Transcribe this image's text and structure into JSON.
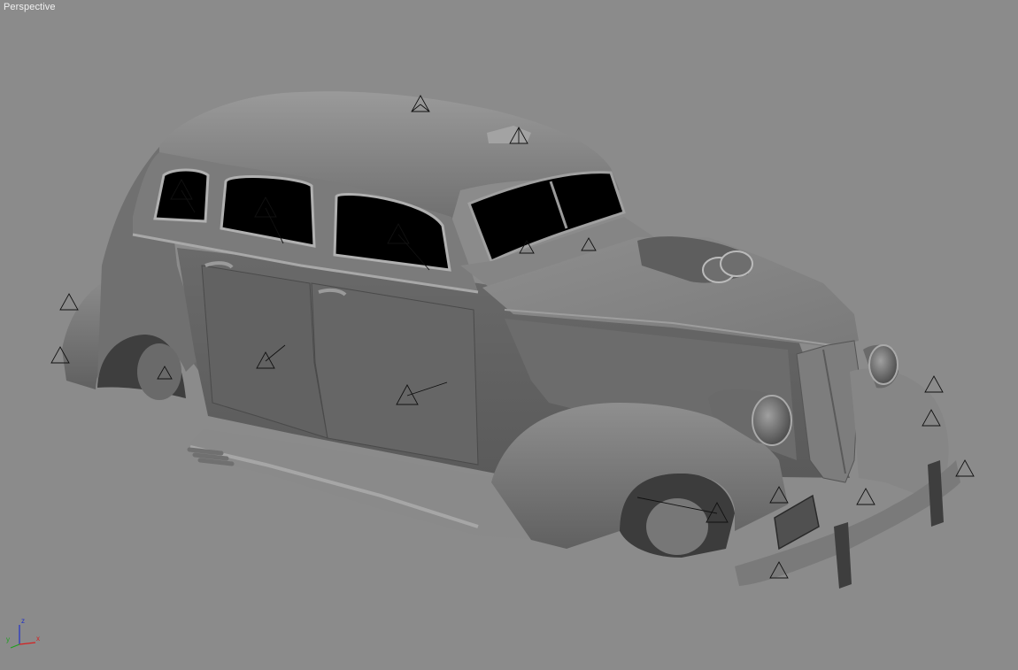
{
  "viewport": {
    "label": "Perspective",
    "background": "#8b8b8b"
  },
  "model": {
    "name": "car-body",
    "body_color": "#7e7e7e",
    "window_color": "#000000"
  },
  "axis_gizmo": {
    "x_label": "x",
    "y_label": "y",
    "z_label": "z",
    "x_color": "#d42020",
    "y_color": "#1ea01e",
    "z_color": "#2030c8"
  },
  "icons": {
    "helper": "light-helper-icon"
  }
}
